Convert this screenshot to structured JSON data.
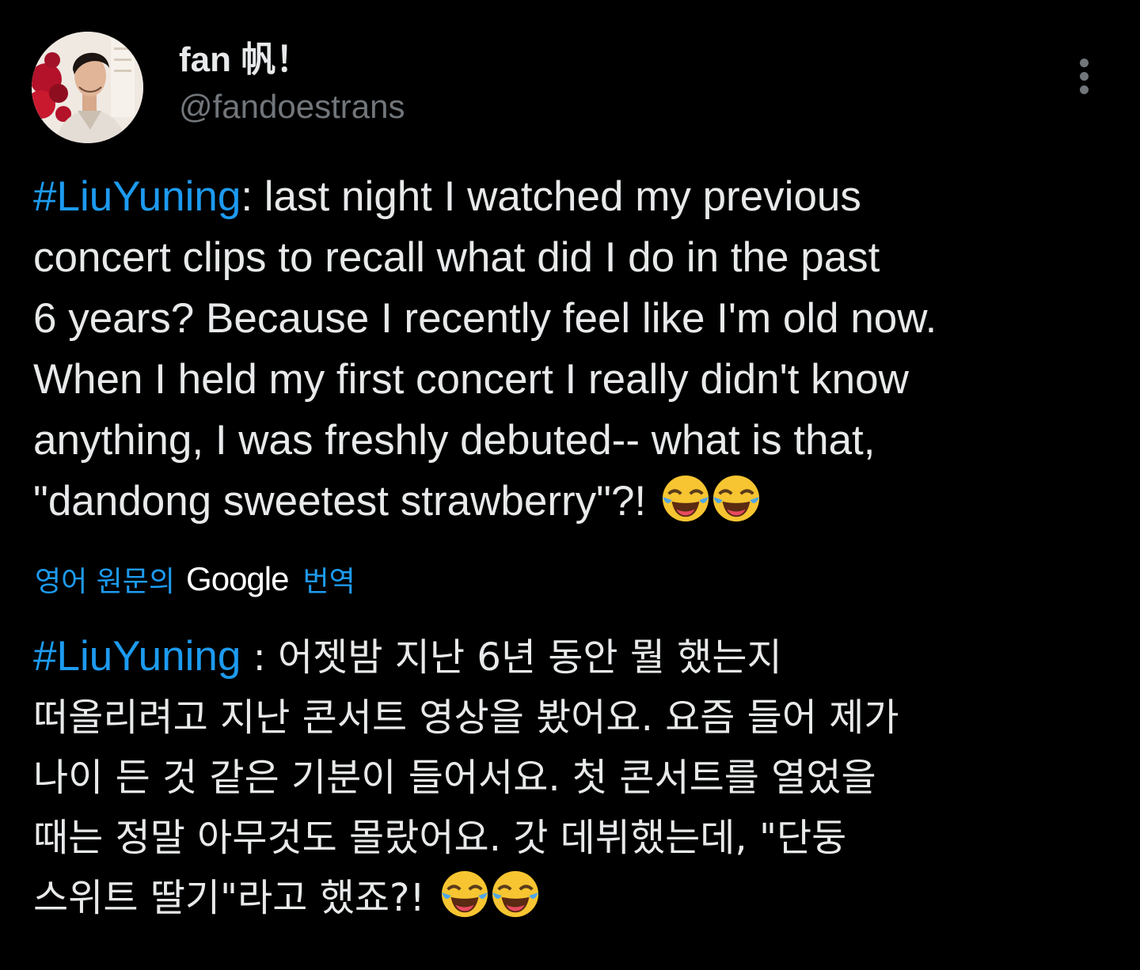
{
  "author": {
    "display_name": "fan 帆！",
    "handle": "@fandoestrans"
  },
  "tweet": {
    "hashtag": "#LiuYuning",
    "line_1_rest": ": last night I watched my previous",
    "line_2": "concert clips to recall what did I do in the past",
    "line_3": "6 years? Because I recently feel like I'm old now.",
    "line_4": "When I held my first concert I really didn't know",
    "line_5": "anything, I was freshly debuted-- what is that,",
    "line_6": "\"dandong sweetest strawberry\"?!",
    "emoji_icon": "face-with-tears-of-joy-icon"
  },
  "translate": {
    "prefix": "영어 원문의",
    "brand": "Google",
    "suffix": "번역"
  },
  "translation": {
    "hashtag": "#LiuYuning",
    "line_1_rest": " : 어젯밤 지난 6년 동안 뭘 했는지",
    "line_2": "떠올리려고 지난 콘서트 영상을 봤어요. 요즘 들어 제가",
    "line_3": "나이 든 것 같은 기분이 들어서요. 첫 콘서트를 열었을",
    "line_4": "때는 정말 아무것도 몰랐어요. 갓 데뷔했는데, \"단둥",
    "line_5": "스위트 딸기\"라고 했죠?!"
  },
  "colors": {
    "background": "#000000",
    "text": "#e7e9ea",
    "secondary": "#71767b",
    "link": "#1d9bf0"
  }
}
